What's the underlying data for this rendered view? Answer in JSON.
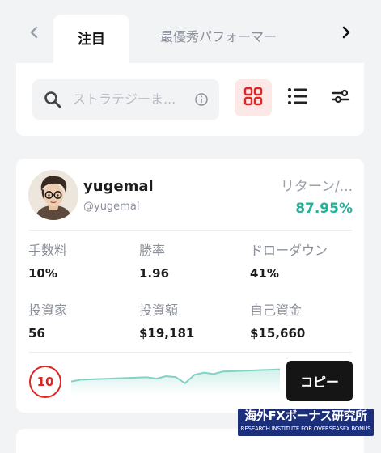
{
  "tabs": {
    "items": [
      {
        "label": "注目",
        "active": true
      },
      {
        "label": "最優秀パフォーマー",
        "active": false
      }
    ]
  },
  "search": {
    "placeholder": "ストラテジーま..."
  },
  "views": [
    {
      "icon": "grid-icon",
      "active": true
    },
    {
      "icon": "list-icon",
      "active": false
    },
    {
      "icon": "filter-sliders-icon",
      "active": false
    }
  ],
  "trader": {
    "name": "yugemal",
    "handle": "@yugemal",
    "return_label": "リターン/...",
    "return_value": "87.95%",
    "stats": [
      {
        "label": "手数料",
        "value": "10%"
      },
      {
        "label": "勝率",
        "value": "1.96"
      },
      {
        "label": "ドローダウン",
        "value": "41%"
      },
      {
        "label": "投資家",
        "value": "56"
      },
      {
        "label": "投資額",
        "value": "$19,181"
      },
      {
        "label": "自己資金",
        "value": "$15,660"
      }
    ],
    "risk_score": "10",
    "sparkline": [
      0.2,
      0.3,
      0.32,
      0.34,
      0.36,
      0.38,
      0.4,
      0.42,
      0.44,
      0.36,
      0.5,
      0.45,
      0.1,
      0.58,
      0.7,
      0.62,
      0.76,
      0.78,
      0.8,
      0.82,
      0.84,
      0.86,
      0.88
    ],
    "copy_label": "コピー"
  },
  "watermark": {
    "main": "海外FXボーナス研究所",
    "sub": "RESEARCH INSTITUTE FOR OVERSEASFX BONUS"
  },
  "colors": {
    "accent_red": "#e02525",
    "return_green": "#20b39a",
    "sparkline": "#7fd3c4"
  }
}
